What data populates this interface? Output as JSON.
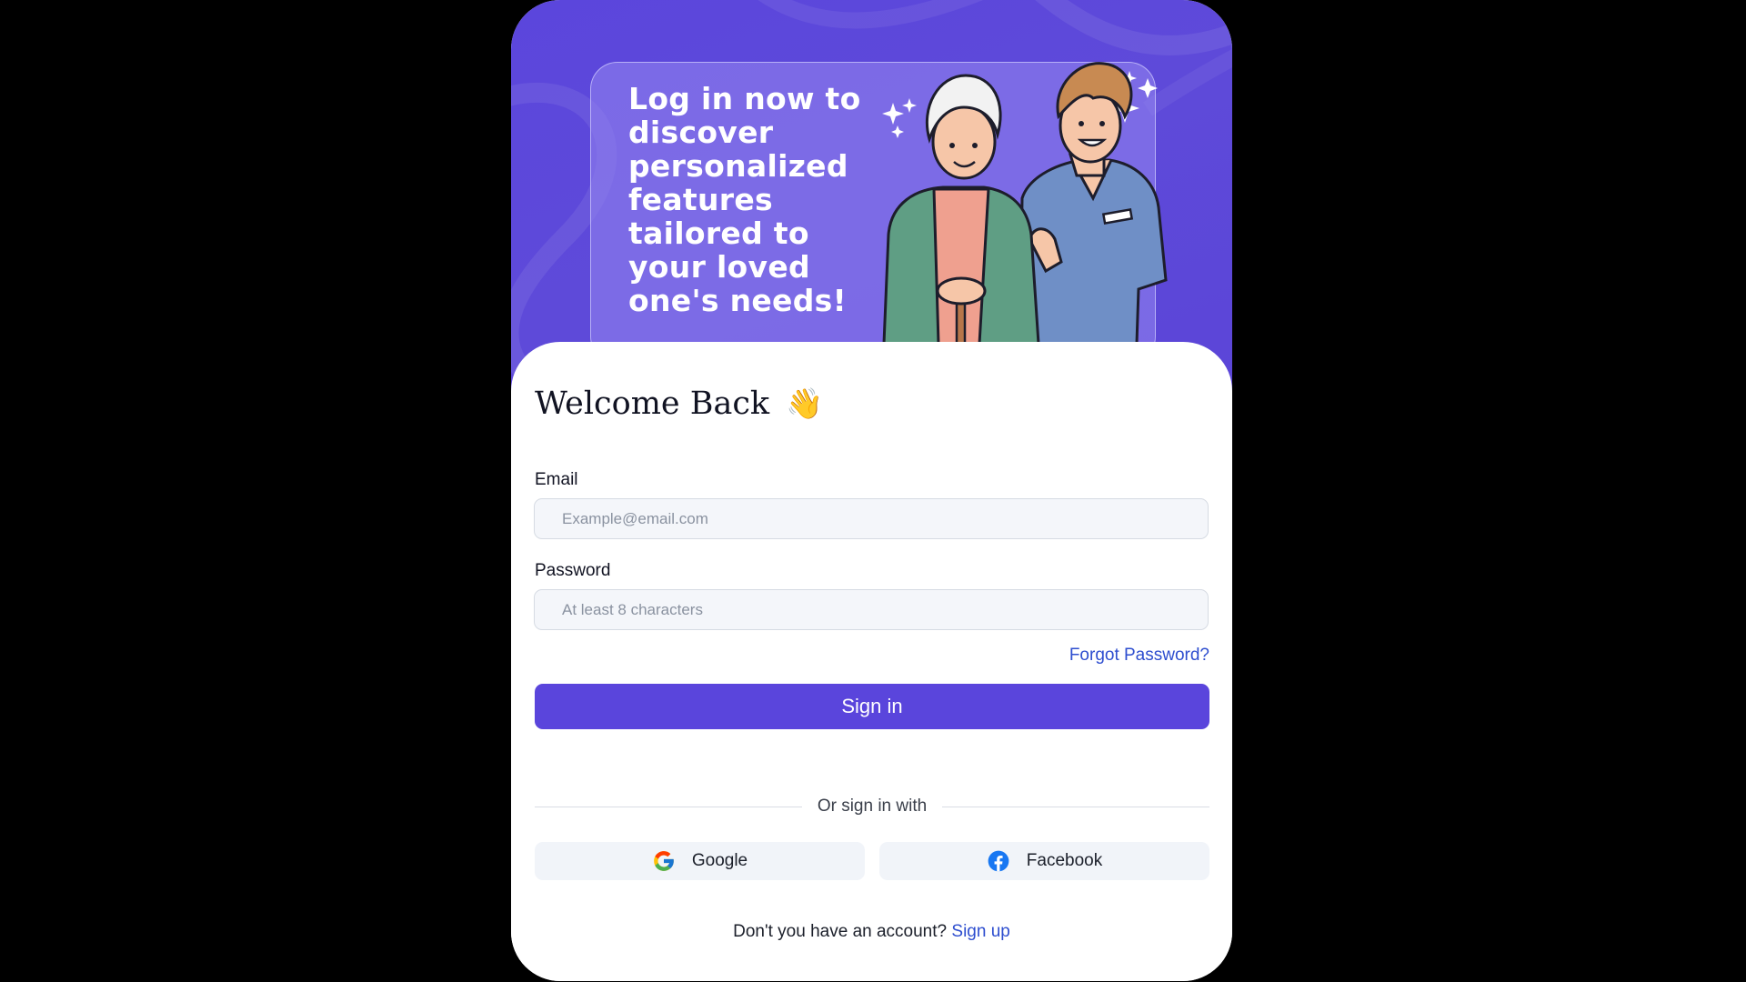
{
  "hero": {
    "headline": "Log in now to discover personalized features tailored to your loved one's needs!",
    "illustration": "caregiver-with-elderly-woman"
  },
  "form": {
    "title": "Welcome Back",
    "title_icon": "waving-hand-icon",
    "email_label": "Email",
    "email_placeholder": "Example@email.com",
    "email_value": "",
    "password_label": "Password",
    "password_placeholder": "At least 8 characters",
    "password_value": "",
    "forgot_label": "Forgot Password?",
    "submit_label": "Sign in"
  },
  "social": {
    "divider_text": "Or sign in with",
    "providers": [
      {
        "label": "Google",
        "icon": "google-icon"
      },
      {
        "label": "Facebook",
        "icon": "facebook-icon"
      }
    ]
  },
  "footer": {
    "prompt": "Don't you have an account?",
    "signup_label": "Sign up"
  },
  "colors": {
    "brand": "#5a45dc",
    "link": "#2e4ecf",
    "page_background": "#000000",
    "input_background": "#f4f6fa"
  }
}
